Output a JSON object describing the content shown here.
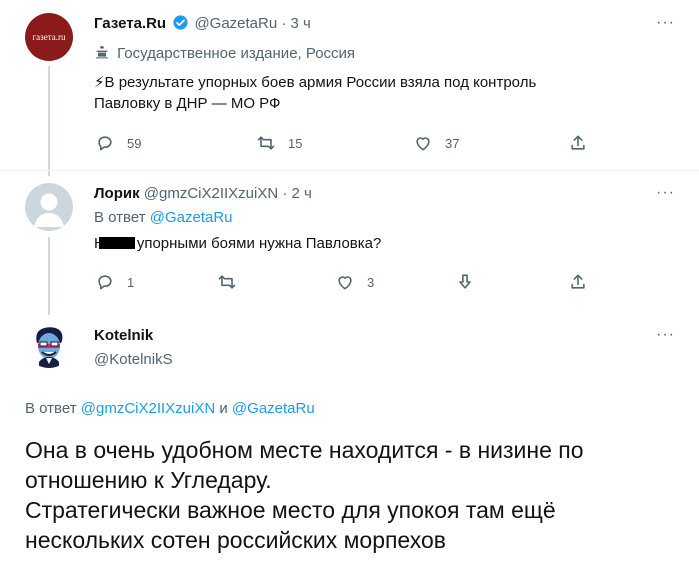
{
  "tweet1": {
    "author_name": "Газета.Ru",
    "handle": "@GazetaRu",
    "time": "3 ч",
    "avatar_text": "газета.ru",
    "label": "Государственное издание, Россия",
    "text_line1": "⚡В результате упорных боев армия России взяла под контроль",
    "text_line2": "Павловку в ДНР — МО РФ",
    "replies": "59",
    "retweets": "15",
    "likes": "37",
    "colors": {
      "avatar_bg": "#8b1a1a",
      "verified": "#1d9bf0",
      "lightning": "#f4b400"
    }
  },
  "tweet2": {
    "author_name": "Лорик",
    "handle": "@gmzCiX2IIXzuiXN",
    "time": "2 ч",
    "reply_prefix": "В ответ",
    "reply_to": "@GazetaRu",
    "text_before": "Н",
    "text_after": "упорными боями нужна Павловка?",
    "replies": "1",
    "likes": "3"
  },
  "tweet3": {
    "author_name": "Kotelnik",
    "handle": "@KotelnikS",
    "reply_prefix": "В ответ",
    "reply_to1": "@gmzCiX2IIXzuiXN",
    "reply_and": "и",
    "reply_to2": "@GazetaRu",
    "text_line1": "Она в очень удобном месте находится - в низине по",
    "text_line2": "отношению к Угледару.",
    "text_line3": "Стратегически важное место для упокоя там ещё",
    "text_line4": "нескольких сотен российских морпехов"
  },
  "icons": [
    "more-icon",
    "verified-icon",
    "state-media-icon",
    "reply-icon",
    "retweet-icon",
    "like-icon",
    "share-icon",
    "downvote-icon",
    "default-avatar-icon"
  ]
}
